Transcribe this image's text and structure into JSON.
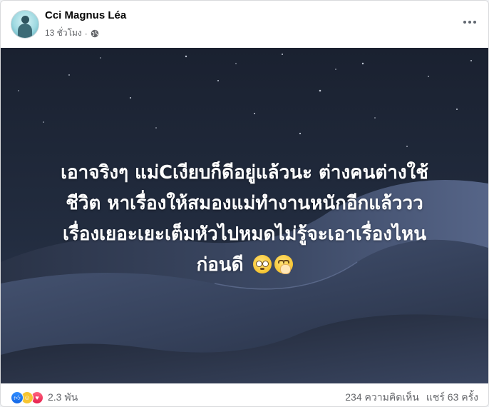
{
  "post": {
    "author": "Cci Magnus Léa",
    "time": "13 ชั่วโมง",
    "separator": "·",
    "privacy_icon": "globe-icon",
    "more_icon": "more-options-icon"
  },
  "image": {
    "caption_lines": [
      "เอาจริงๆ แม่Cเงียบก็ดีอยู่แล้วนะ ต่างคนต่างใช้",
      "ชีวิต หาเรื่องให้สมองแม่ทำงานหนักอีกแล้ววว",
      "เรื่องเยอะเยะเต็มหัวไปหมดไม่รู้จะเอาเรื่องไหน",
      "ก่อนดี"
    ],
    "emojis": [
      "pleading-face-emoji",
      "face-with-hand-over-mouth-emoji"
    ],
    "background_colors": {
      "sky": "#1b2332",
      "dune": "#3a4660"
    }
  },
  "footer": {
    "reaction_icons": [
      "like-icon",
      "care-icon",
      "love-icon"
    ],
    "reaction_count": "2.3 พัน",
    "comments": "234 ความคิดเห็น",
    "shares": "แชร์ 63 ครั้ง"
  }
}
